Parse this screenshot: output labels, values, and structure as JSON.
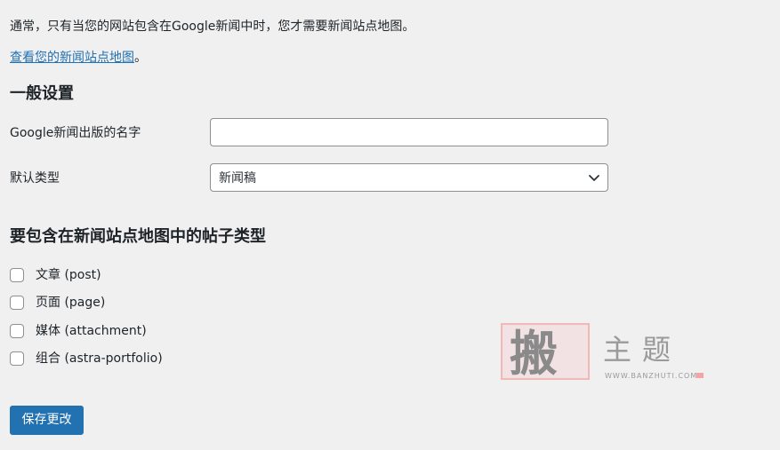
{
  "intro": {
    "text": "通常，只有当您的网站包含在Google新闻中时，您才需要新闻站点地图。",
    "link_text": "查看您的新闻站点地图",
    "link_suffix": "。"
  },
  "general": {
    "heading": "一般设置",
    "publication_name": {
      "label": "Google新闻出版的名字",
      "value": "",
      "placeholder": ""
    },
    "default_type": {
      "label": "默认类型",
      "selected": "新闻稿"
    }
  },
  "post_types": {
    "heading": "要包含在新闻站点地图中的帖子类型",
    "items": [
      {
        "label": "文章 (post)",
        "checked": false
      },
      {
        "label": "页面 (page)",
        "checked": false
      },
      {
        "label": "媒体 (attachment)",
        "checked": false
      },
      {
        "label": "组合 (astra-portfolio)",
        "checked": false
      }
    ]
  },
  "save_button": {
    "label": "保存更改"
  },
  "watermark": {
    "big_char": "搬",
    "title": "主题",
    "url": "WWW.BANZHUTI.COM"
  },
  "colors": {
    "background": "#f0f0f1",
    "accent": "#2271b1",
    "text": "#1d2327"
  },
  "icons": {
    "select_arrow": "chevron-down-icon"
  }
}
